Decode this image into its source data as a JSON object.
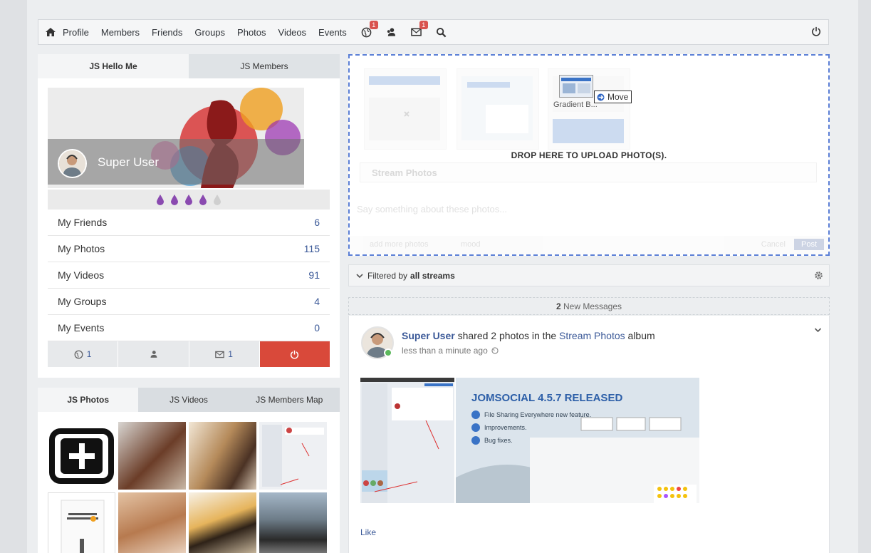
{
  "nav": {
    "links": [
      "Profile",
      "Members",
      "Friends",
      "Groups",
      "Photos",
      "Videos",
      "Events"
    ],
    "notif_badge_globe": "1",
    "notif_badge_mail": "1"
  },
  "hello": {
    "tabs": [
      "JS Hello Me",
      "JS Members"
    ],
    "user_name": "Super User",
    "stats": [
      {
        "label": "My Friends",
        "value": "6"
      },
      {
        "label": "My Photos",
        "value": "115"
      },
      {
        "label": "My Videos",
        "value": "91"
      },
      {
        "label": "My Groups",
        "value": "4"
      },
      {
        "label": "My Events",
        "value": "0"
      }
    ],
    "actions": {
      "globe_count": "1",
      "mail_count": "1"
    }
  },
  "photos_panel": {
    "tabs": [
      "JS Photos",
      "JS Videos",
      "JS Members Map"
    ]
  },
  "upload": {
    "drop_label": "DROP HERE TO UPLOAD PHOTO(S).",
    "album": "Stream Photos",
    "placeholder": "Say something about these photos...",
    "add_more": "add more photos",
    "mood": "mood",
    "cancel": "Cancel",
    "post": "Post",
    "drag_file": "Gradient B...",
    "move_tip": "Move"
  },
  "filter": {
    "prefix": "Filtered by",
    "value": "all streams"
  },
  "new_messages": {
    "count": "2",
    "label": "New Messages"
  },
  "post": {
    "author": "Super User",
    "action": "shared 2 photos in the",
    "album": "Stream Photos",
    "suffix": "album",
    "time": "less than a minute ago",
    "img_title": "JOMSOCIAL 4.5.7 RELEASED",
    "bullets": [
      "File Sharing Everywhere new feature.",
      "Improvements.",
      "Bug fixes."
    ],
    "like": "Like"
  },
  "colors": {
    "accent": "#3b5998",
    "danger": "#d9493a",
    "online": "#5cb85c"
  }
}
